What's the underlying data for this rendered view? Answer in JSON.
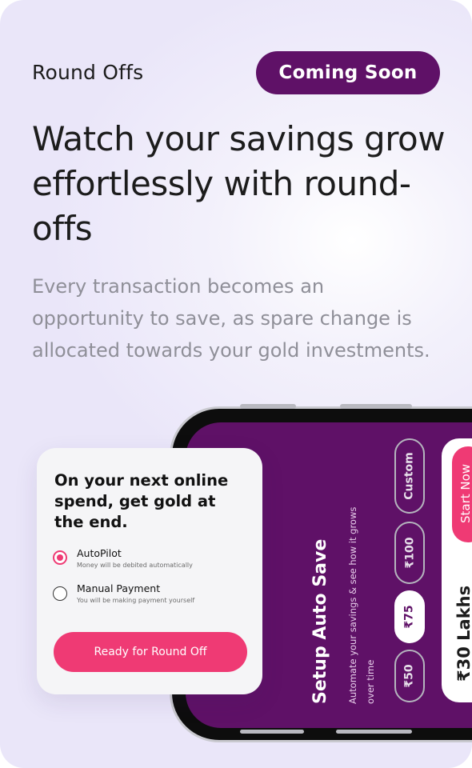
{
  "header": {
    "eyebrow": "Round Offs",
    "badge": "Coming Soon"
  },
  "hero": {
    "headline": "Watch your savings grow effortlessly with round-offs",
    "description": "Every transaction becomes an opportunity to save, as spare change is allocated towards your gold investments."
  },
  "phone_screen": {
    "title": "Setup Auto Save",
    "subtitle": "Automate your savings & see how it grows over time",
    "amounts": [
      "₹50",
      "₹75",
      "₹100",
      "Custom"
    ],
    "selected_amount": "₹75",
    "start_button": "Start Now",
    "projection": "₹30 Lakhs"
  },
  "popup": {
    "title": "On your next online spend, get gold at the end.",
    "options": [
      {
        "label": "AutoPilot",
        "sub": "Money will be debited automatically",
        "selected": true
      },
      {
        "label": "Manual Payment",
        "sub": "You will be making payment yourself",
        "selected": false
      }
    ],
    "cta": "Ready for Round Off"
  },
  "colors": {
    "brand_purple": "#5f1167",
    "accent_pink": "#ef3a74"
  }
}
